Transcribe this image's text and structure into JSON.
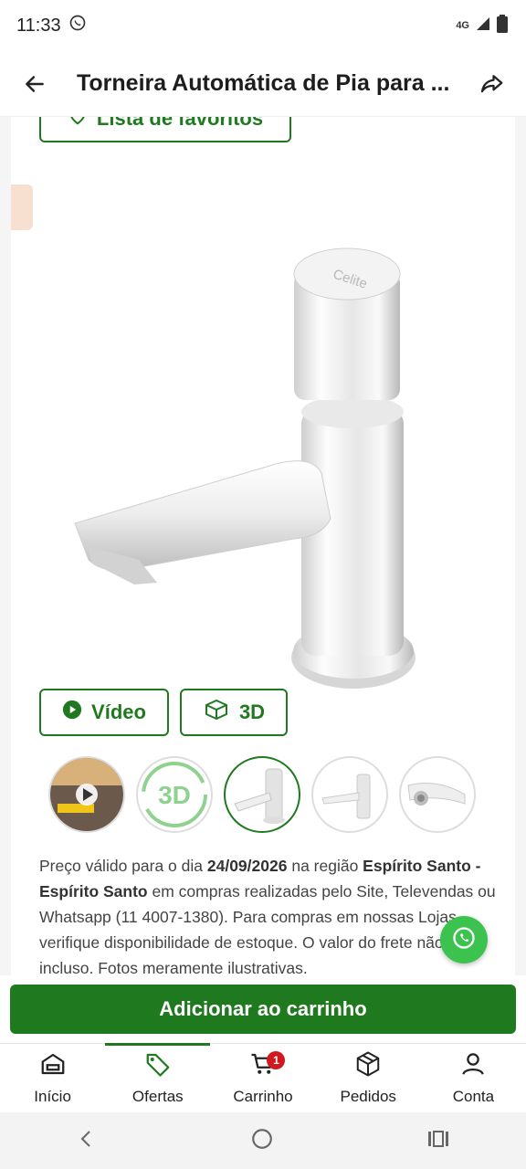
{
  "status": {
    "time": "11:33",
    "network": "4G"
  },
  "header": {
    "title": "Torneira Automática de Pia para ..."
  },
  "product": {
    "favorites_label": "Lista de favoritos",
    "video_label": "Vídeo",
    "view3d_label": "3D",
    "thumbnails": [
      "video-thumbnail",
      "3d-thumbnail",
      "front-view",
      "side-view",
      "bottom-view"
    ],
    "image_brand_text": "Celite"
  },
  "price_note": {
    "part1": "Preço válido para o dia ",
    "date": "24/09/2026",
    "part2": " na região ",
    "region": "Espírito Santo - Espírito Santo",
    "part3": " em compras realizadas pelo Site, Televendas ou Whatsapp (11 4007-1380). Para compras em nossas Lojas, verifique disponibilidade de estoque. O valor do frete não está incluso. Fotos meramente ilustrativas."
  },
  "cart_button": {
    "label": "Adicionar ao carrinho"
  },
  "bottom_nav": {
    "items": [
      {
        "label": "Início",
        "icon": "store-icon"
      },
      {
        "label": "Ofertas",
        "icon": "tag-icon"
      },
      {
        "label": "Carrinho",
        "icon": "cart-icon",
        "badge": "1"
      },
      {
        "label": "Pedidos",
        "icon": "box-icon"
      },
      {
        "label": "Conta",
        "icon": "user-icon"
      }
    ],
    "active_index": 1
  },
  "colors": {
    "brand_green": "#1f7a1f",
    "badge_red": "#d0191f",
    "whatsapp": "#3cc34f"
  }
}
